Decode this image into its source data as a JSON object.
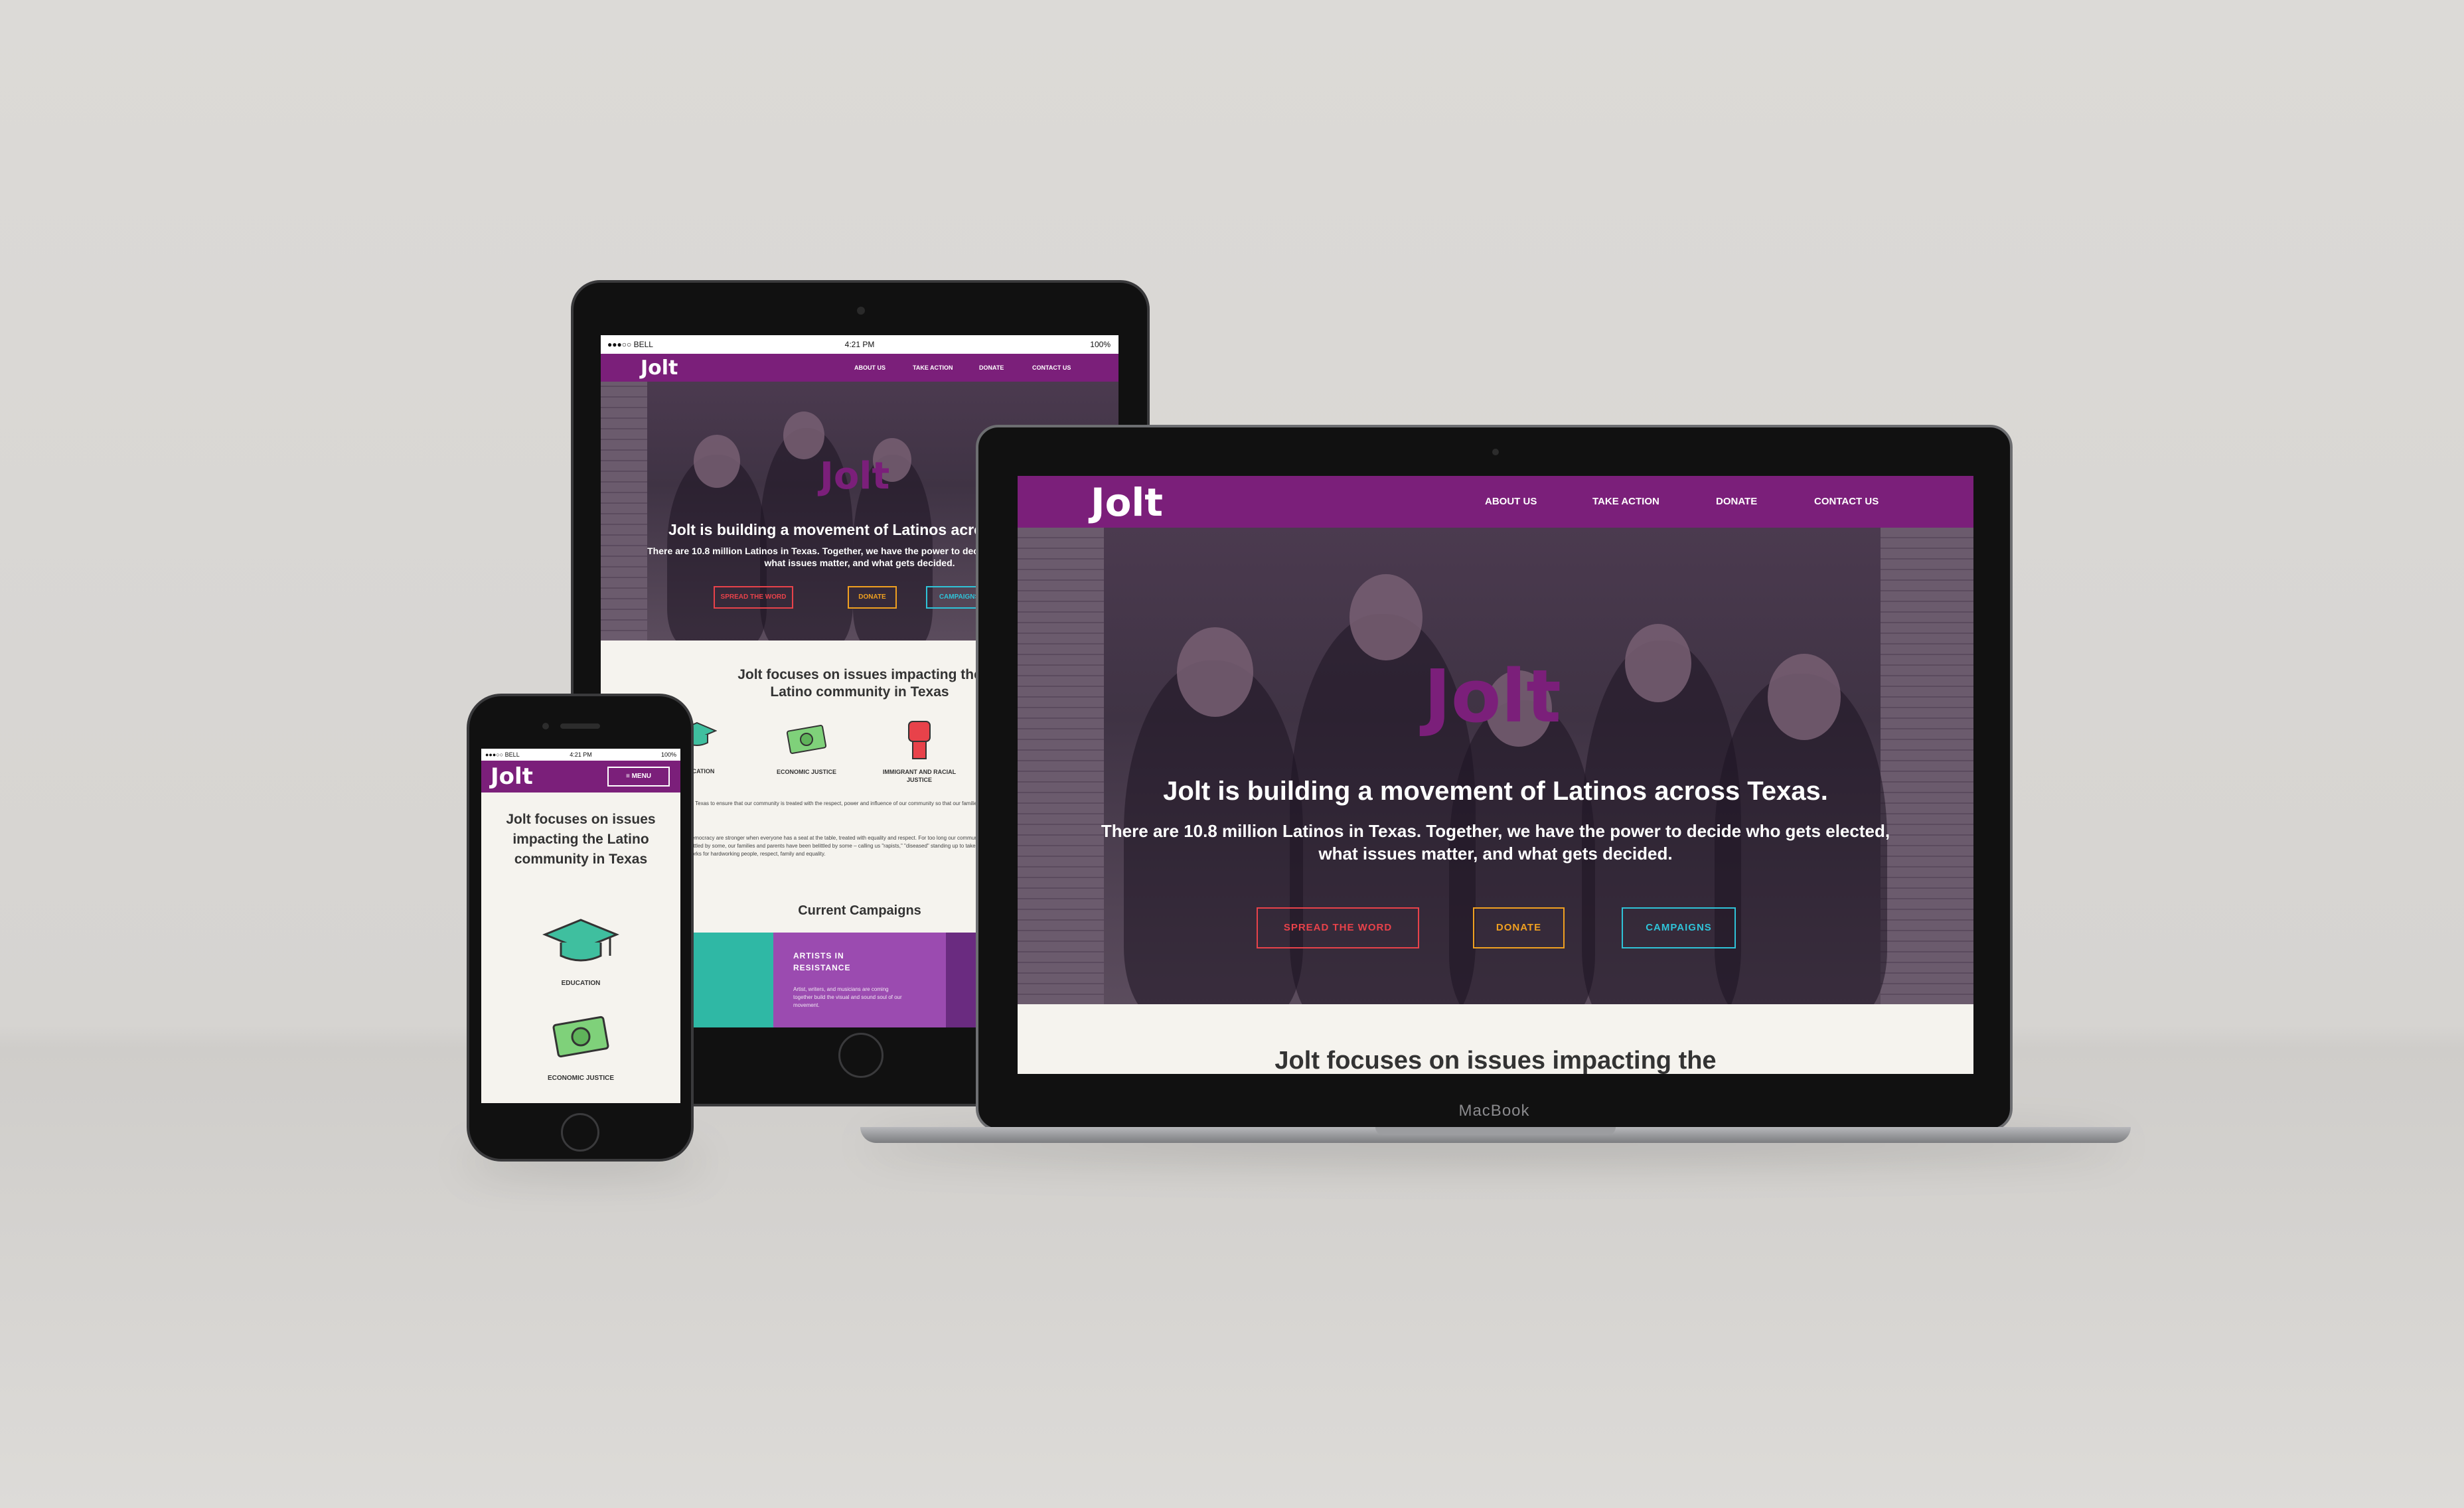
{
  "site": {
    "logo_text": "Jolt",
    "nav": [
      "ABOUT US",
      "TAKE ACTION",
      "DONATE",
      "CONTACT US"
    ],
    "hero_title": "Jolt is building a movement of Latinos across Texas.",
    "hero_sub": "There are 10.8 million Latinos in Texas. Together, we have the power to decide who gets elected, what issues matter, and what gets decided.",
    "buttons": [
      "SPREAD THE WORD",
      "DONATE",
      "CAMPAIGNS"
    ],
    "focus_heading_desktop": "Jolt focuses on issues impacting the",
    "focus_heading_full": "Jolt focuses on issues impacting the Latino community in Texas",
    "focus_heading_tablet_1": "Jolt focuses on issues impacting the",
    "focus_heading_tablet_2": "Latino community in Texas",
    "features": [
      "EDUCATION",
      "ECONOMIC JUSTICE",
      "IMMIGRANT AND RACIAL JUSTICE"
    ],
    "current_campaigns": "Current Campaigns",
    "campaign_card_title": "ARTISTS IN RESISTANCE",
    "campaign_card_body": "Artist, writers, and musicians are coming together build the visual and sound soul of our movement.",
    "menu_label": "≡ MENU",
    "body_paragraph_1": "movement of Latinos across Texas to ensure that our community is treated with the respect, power and influence of our community so that our families are treated with equality and respect.",
    "body_paragraph_2": "is simple – Texas and our democracy are stronger when everyone has a seat at the table, treated with equality and respect. For too long our community and our contributions have been belittled by some, our families and parents have been belittled by some – calling us \"rapists,\" \"diseased\" standing up to take back our state and democracy, so that it works for hardworking people, respect, family and equality."
  },
  "device_status": {
    "carrier": "●●●○○ BELL",
    "time": "4:21 PM",
    "battery": "100%"
  },
  "laptop_label": "MacBook",
  "colors": {
    "brand_purple": "#7b1f7a",
    "spread_red": "#e8424a",
    "donate_orange": "#f0a020",
    "campaigns_cyan": "#2fc3d8",
    "cream": "#f5f3ee"
  }
}
